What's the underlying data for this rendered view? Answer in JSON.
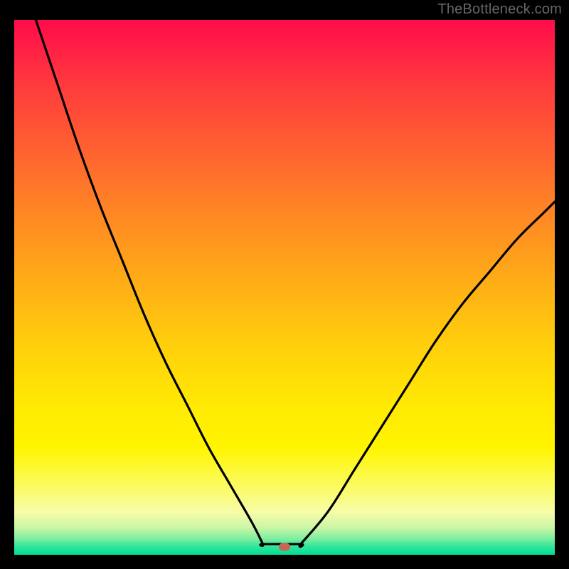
{
  "watermark": "TheBottleneck.com",
  "colors": {
    "frame_bg": "#000000",
    "curve_stroke": "#000000",
    "marker_fill": "#c96458",
    "gradient_top": "#ff0c4a",
    "gradient_bottom": "#00de95"
  },
  "chart_data": {
    "type": "line",
    "title": "",
    "subtitle": "",
    "xlabel": "",
    "ylabel": "",
    "xlim": [
      0,
      100
    ],
    "ylim": [
      0,
      100
    ],
    "grid": false,
    "legend": false,
    "annotations": [],
    "marker": {
      "x": 50,
      "y": 1.5
    },
    "series": [
      {
        "name": "left-branch",
        "x": [
          4,
          8,
          12,
          16,
          20,
          24,
          28,
          32,
          36,
          40,
          44,
          46
        ],
        "values": [
          100,
          88,
          76,
          65,
          55,
          45,
          36,
          28,
          20,
          13,
          6,
          2
        ]
      },
      {
        "name": "flat-segment",
        "x": [
          46,
          53
        ],
        "values": [
          2,
          2
        ]
      },
      {
        "name": "right-branch",
        "x": [
          53,
          58,
          63,
          68,
          73,
          78,
          83,
          88,
          93,
          98,
          100
        ],
        "values": [
          2,
          8,
          16,
          24,
          32,
          40,
          47,
          53,
          59,
          64,
          66
        ]
      }
    ]
  }
}
